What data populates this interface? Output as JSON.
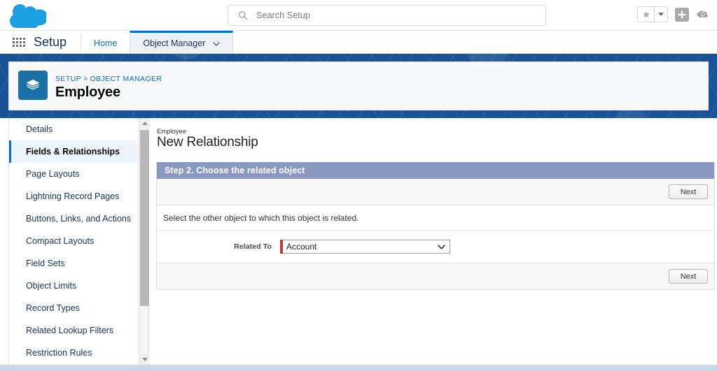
{
  "header": {
    "logo_icon": "salesforce-cloud-icon",
    "search": {
      "icon": "search-icon",
      "placeholder": "Search Setup",
      "value": ""
    },
    "actions": [
      {
        "name": "favorites-star-icon",
        "label": ""
      },
      {
        "name": "favorites-dropdown-caret-icon",
        "label": ""
      },
      {
        "name": "add-plus-icon",
        "label": ""
      },
      {
        "name": "setup-gear-cloud-icon",
        "label": ""
      }
    ]
  },
  "setup_nav": {
    "app_launcher_icon": "app-launcher-waffle-icon",
    "setup_label": "Setup",
    "tabs": [
      {
        "label": "Home",
        "active": false
      },
      {
        "label": "Object Manager",
        "active": true,
        "caret_icon": "chevron-down-icon"
      }
    ]
  },
  "object_header": {
    "icon": "standard-object-layers-icon",
    "breadcrumb": {
      "root": "SETUP",
      "separator": ">",
      "current": "OBJECT MANAGER"
    },
    "title": "Employee"
  },
  "sidebar": {
    "scrollbar": {
      "up_arrow_icon": "scroll-up-arrow-icon",
      "down_arrow_icon": "scroll-down-arrow-icon"
    },
    "items": [
      {
        "label": "Details",
        "active": false
      },
      {
        "label": "Fields & Relationships",
        "active": true
      },
      {
        "label": "Page Layouts",
        "active": false
      },
      {
        "label": "Lightning Record Pages",
        "active": false
      },
      {
        "label": "Buttons, Links, and Actions",
        "active": false
      },
      {
        "label": "Compact Layouts",
        "active": false
      },
      {
        "label": "Field Sets",
        "active": false
      },
      {
        "label": "Object Limits",
        "active": false
      },
      {
        "label": "Record Types",
        "active": false
      },
      {
        "label": "Related Lookup Filters",
        "active": false
      },
      {
        "label": "Restriction Rules",
        "active": false
      }
    ]
  },
  "main": {
    "eyebrow": "Employee",
    "title": "New Relationship",
    "step_header": "Step 2. Choose the related object",
    "instruction": "Select the other object to which this object is related.",
    "field": {
      "label": "Related To",
      "required": true,
      "selected": "Account",
      "caret_icon": "chevron-down-icon",
      "options": [
        "Account"
      ]
    },
    "top_buttons": [
      {
        "label": "Next"
      }
    ],
    "bottom_buttons": [
      {
        "label": "Next"
      }
    ]
  },
  "colors": {
    "brand_blue": "#0070d2",
    "banner_blue": "#1b5297",
    "step_header": "#8b99c1",
    "required_red": "#c23934",
    "object_icon": "#1b70a5",
    "cloud_logo": "#1ca0e4"
  }
}
